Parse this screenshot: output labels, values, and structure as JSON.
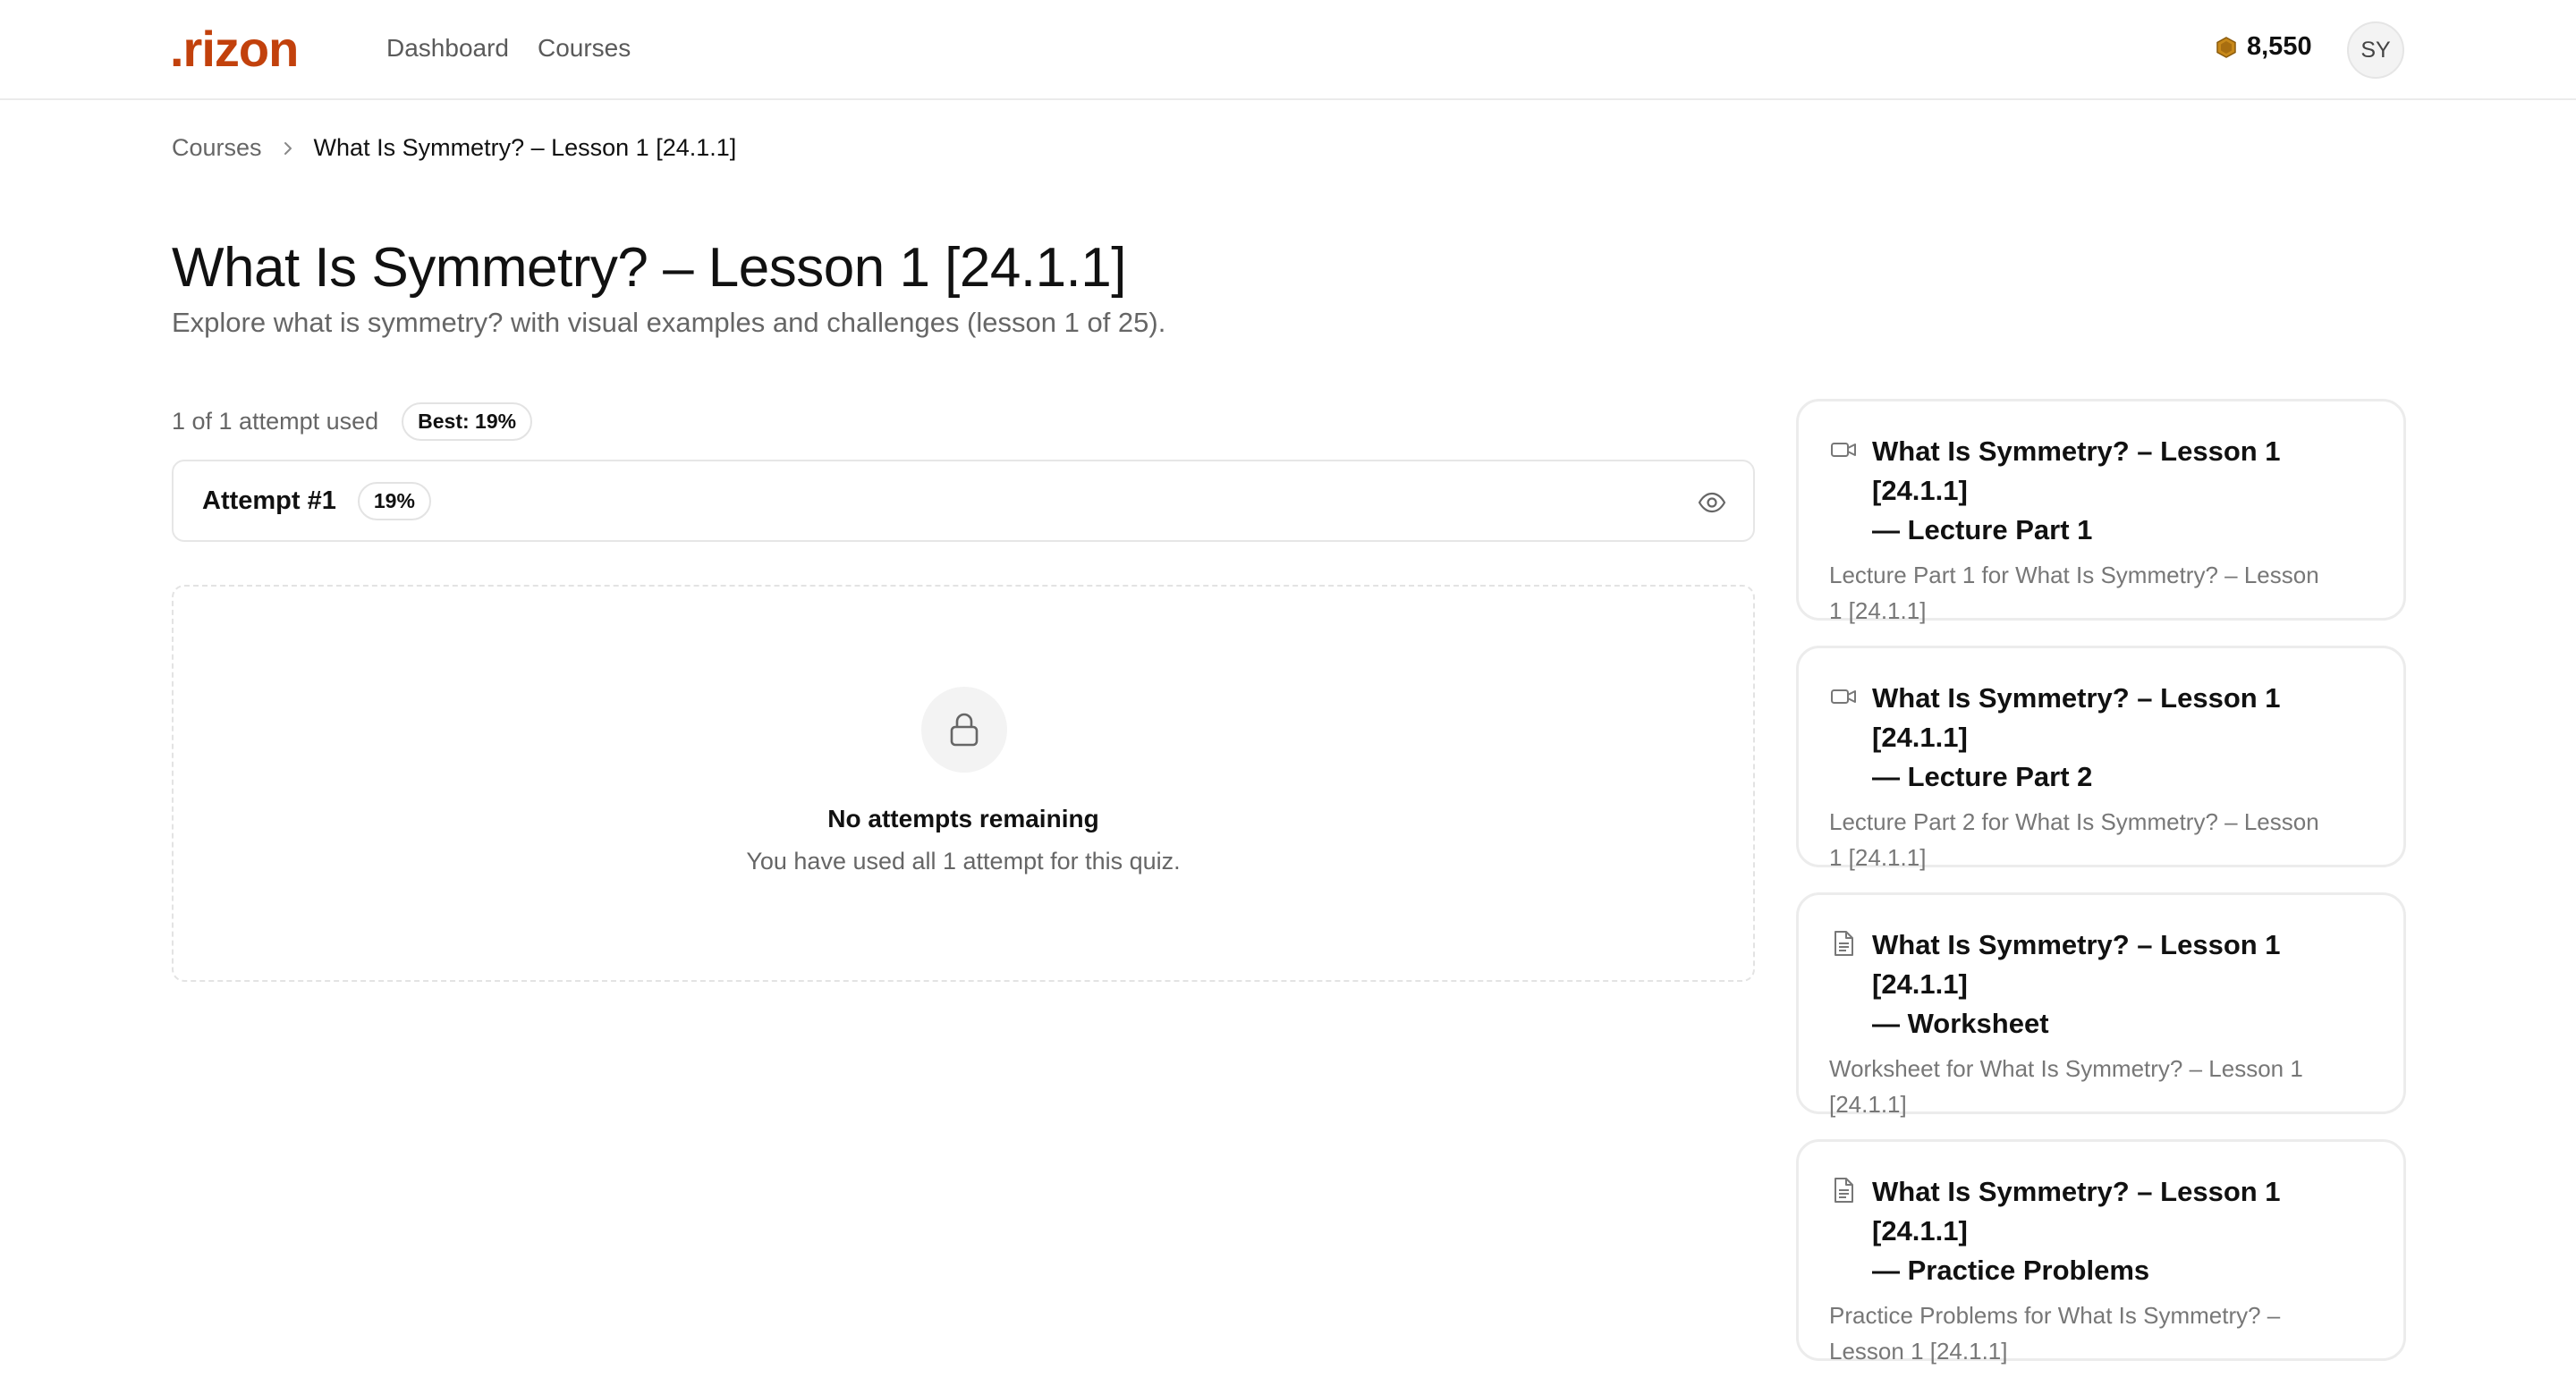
{
  "header": {
    "logo": ".rizon",
    "nav": [
      "Dashboard",
      "Courses"
    ],
    "coins": "8,550",
    "coin_icon": "coin-icon",
    "avatar_initials": "SY",
    "brand_color": "#c2410c"
  },
  "breadcrumb": {
    "parent": "Courses",
    "current": "What Is Symmetry? – Lesson 1 [24.1.1]"
  },
  "page": {
    "title": "What Is Symmetry? – Lesson 1 [24.1.1]",
    "subtitle": "Explore what is symmetry? with visual examples and challenges (lesson 1 of 25)."
  },
  "attempts": {
    "used_text": "1 of 1 attempt used",
    "best_badge": "Best: 19%",
    "list": [
      {
        "label": "Attempt #1",
        "score": "19%"
      }
    ]
  },
  "locked": {
    "icon": "lock-icon",
    "title": "No attempts remaining",
    "message": "You have used all 1 attempt for this quiz."
  },
  "sidebar": {
    "items": [
      {
        "icon": "video-icon",
        "title_line1": "What Is Symmetry? – Lesson 1 [24.1.1]",
        "title_line2": "— Lecture Part 1",
        "desc_line1": "Lecture Part 1 for What Is Symmetry? – Lesson",
        "desc_line2": "1 [24.1.1]"
      },
      {
        "icon": "video-icon",
        "title_line1": "What Is Symmetry? – Lesson 1 [24.1.1]",
        "title_line2": "— Lecture Part 2",
        "desc_line1": "Lecture Part 2 for What Is Symmetry? – Lesson",
        "desc_line2": "1 [24.1.1]"
      },
      {
        "icon": "document-icon",
        "title_line1": "What Is Symmetry? – Lesson 1 [24.1.1]",
        "title_line2": "— Worksheet",
        "desc_line1": "Worksheet for What Is Symmetry? – Lesson 1",
        "desc_line2": "[24.1.1]"
      },
      {
        "icon": "document-icon",
        "title_line1": "What Is Symmetry? – Lesson 1 [24.1.1]",
        "title_line2": "— Practice Problems",
        "desc_line1": "Practice Problems for What Is Symmetry? –",
        "desc_line2": "Lesson 1 [24.1.1]"
      }
    ]
  }
}
